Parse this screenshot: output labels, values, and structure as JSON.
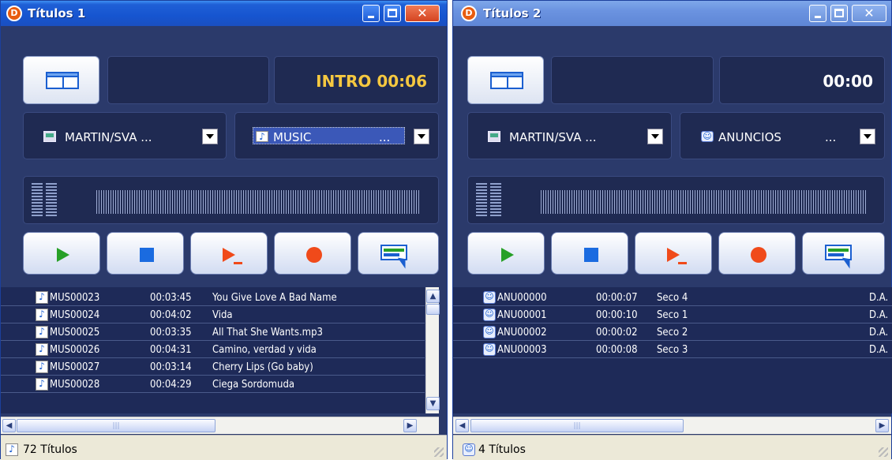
{
  "colors": {
    "timer_yellow": "#f5c840",
    "timer_white": "#ffffff",
    "play_green": "#27a027",
    "stop_blue": "#1a6be0",
    "rec_red": "#f04a1a"
  },
  "windows": [
    {
      "app_icon": "D",
      "title": "Títulos 1",
      "timer": "INTRO 00:06",
      "source_select": {
        "icon": "computer-icon",
        "value": "MARTIN/SVA ..."
      },
      "category_select": {
        "icon": "music-note-icon",
        "value": "MUSIC",
        "ellipsis": "..."
      },
      "rows": [
        {
          "id": "MUS00023",
          "duration": "00:03:45",
          "title": "You Give Love A Bad Name"
        },
        {
          "id": "MUS00024",
          "duration": "00:04:02",
          "title": "Vida"
        },
        {
          "id": "MUS00025",
          "duration": "00:03:35",
          "title": "All That She Wants.mp3"
        },
        {
          "id": "MUS00026",
          "duration": "00:04:31",
          "title": "Camino, verdad y vida"
        },
        {
          "id": "MUS00027",
          "duration": "00:03:14",
          "title": "Cherry Lips (Go baby)"
        },
        {
          "id": "MUS00028",
          "duration": "00:04:29",
          "title": "Ciega Sordomuda"
        }
      ],
      "status": "72 Títulos"
    },
    {
      "app_icon": "D",
      "title": "Títulos 2",
      "timer": "00:00",
      "source_select": {
        "icon": "computer-icon",
        "value": "MARTIN/SVA ..."
      },
      "category_select": {
        "icon": "ad-icon",
        "value": "ANUNCIOS",
        "ellipsis": "..."
      },
      "rows": [
        {
          "id": "ANU00000",
          "duration": "00:00:07",
          "title": "Seco 4",
          "extra": "D.A."
        },
        {
          "id": "ANU00001",
          "duration": "00:00:10",
          "title": "Seco 1",
          "extra": "D.A."
        },
        {
          "id": "ANU00002",
          "duration": "00:00:02",
          "title": "Seco 2",
          "extra": "D.A."
        },
        {
          "id": "ANU00003",
          "duration": "00:00:08",
          "title": "Seco 3",
          "extra": "D.A."
        }
      ],
      "status": "4 Títulos"
    }
  ]
}
